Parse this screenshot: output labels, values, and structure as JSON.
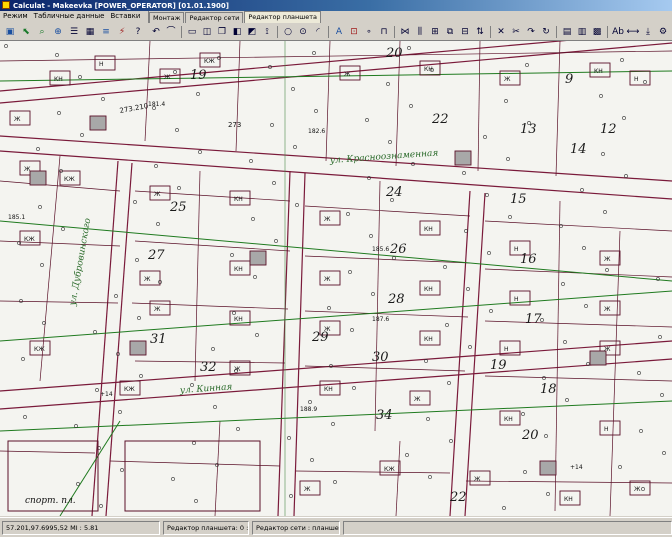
{
  "window": {
    "title": "Calculat - Makeevka [POWER_OPERATOR] [01.01.1900]"
  },
  "menu": [
    {
      "label": "Режим"
    },
    {
      "label": "Табличные данные"
    },
    {
      "label": "Вставки"
    }
  ],
  "tabs": [
    {
      "label": "Монтаж"
    },
    {
      "label": "Редактор сети"
    },
    {
      "label": "Редактор планшета"
    }
  ],
  "active_tab": 2,
  "map_labels": {
    "street_krasnoznamennaya": "ул. Красноознаменная",
    "street_dubrovinskogo": "ул. Дубровинского",
    "street_kinnaya": "ул. Кинная",
    "sport_ground": "спорт. пл.",
    "elev_1": "181.4",
    "elev_2": "182.6",
    "elev_3": "185.6",
    "elev_4": "187.6",
    "elev_5": "188.9",
    "elev_6": "185.1",
    "marker_1": "+14",
    "marker_2": "+14",
    "lot_a": "273.210",
    "lot_b": "273"
  },
  "house_numbers": [
    "20",
    "19",
    "9",
    "12",
    "22",
    "13",
    "14",
    "25",
    "24",
    "26",
    "15",
    "27",
    "28",
    "16",
    "31",
    "29",
    "30",
    "17",
    "32",
    "18",
    "19",
    "34",
    "20",
    "22"
  ],
  "house_types": [
    "Ж",
    "КН",
    "Н",
    "Ж",
    "КЖ",
    "Ж",
    "КН"
  ],
  "status": {
    "coords": "57.201,97.6995,52 МI : 5.81",
    "mode": "Редактор планшета: 0 : 0",
    "message": "Редактор сети : планшета"
  },
  "colors": {
    "titlebar": "#0a246a",
    "chrome": "#d4d0c8",
    "map_lines": "#7a1a3a",
    "map_text": "#2a8a2a"
  }
}
